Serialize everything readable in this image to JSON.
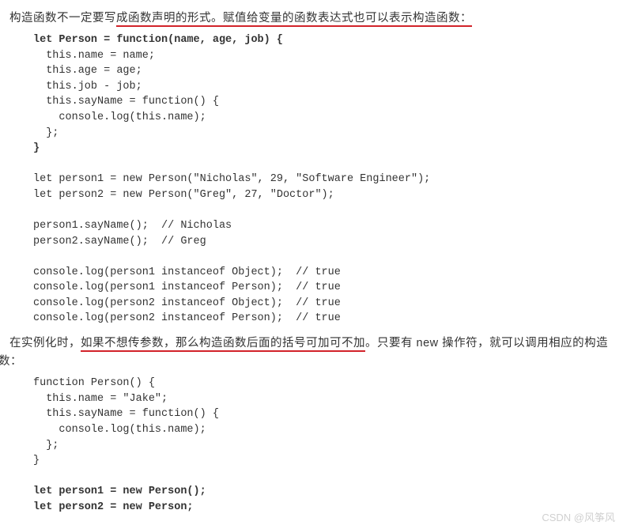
{
  "para1": {
    "plain_before": "构造函数不一定要写",
    "underlined": "成函数声明的形式。赋值给变量的函数表达式也可以表示构造函数：",
    "plain_after": ""
  },
  "code1": {
    "l01_kw": "let Person = function(name, age, job) {",
    "l02": "  this.name = name;",
    "l03": "  this.age = age;",
    "l04": "  this.job - job;",
    "l05": "  this.sayName = function() {",
    "l06": "    console.log(this.name);",
    "l07": "  };",
    "l08_kw": "}",
    "l09": "",
    "l10": "let person1 = new Person(\"Nicholas\", 29, \"Software Engineer\");",
    "l11": "let person2 = new Person(\"Greg\", 27, \"Doctor\");",
    "l12": "",
    "l13": "person1.sayName();  // Nicholas",
    "l14": "person2.sayName();  // Greg",
    "l15": "",
    "l16": "console.log(person1 instanceof Object);  // true",
    "l17": "console.log(person1 instanceof Person);  // true",
    "l18": "console.log(person2 instanceof Object);  // true",
    "l19": "console.log(person2 instanceof Person);  // true"
  },
  "para2": {
    "lead": "在实例化时，",
    "underlined": "如果不想传参数，那么构造函数后面的括号可加可不加",
    "tail": "。只要有 new 操作符，就可以调用相应的构造函数："
  },
  "code2": {
    "l01": "function Person() {",
    "l02": "  this.name = \"Jake\";",
    "l03": "  this.sayName = function() {",
    "l04": "    console.log(this.name);",
    "l05": "  };",
    "l06": "}",
    "l07": "",
    "l08_kw": "let person1 = new Person();",
    "l09_kw": "let person2 = new Person;"
  },
  "watermark": "CSDN @风筝风"
}
